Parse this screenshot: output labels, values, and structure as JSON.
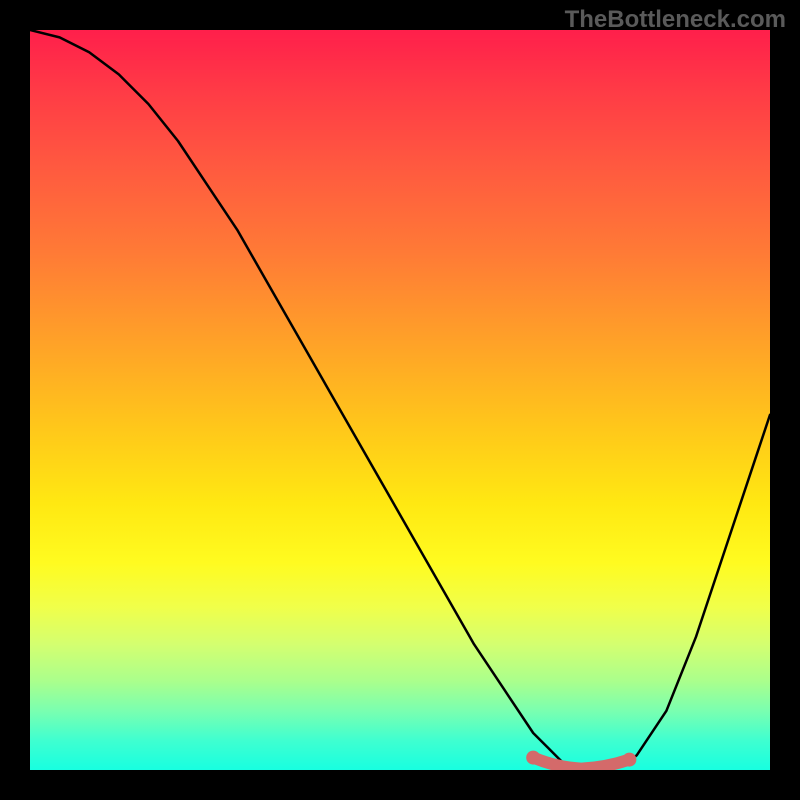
{
  "watermark": "TheBottleneck.com",
  "chart_data": {
    "type": "line",
    "title": "",
    "xlabel": "",
    "ylabel": "",
    "xlim": [
      0,
      100
    ],
    "ylim": [
      0,
      100
    ],
    "series": [
      {
        "name": "bottleneck-curve",
        "x": [
          0,
          4,
          8,
          12,
          16,
          20,
          24,
          28,
          32,
          36,
          40,
          44,
          48,
          52,
          56,
          60,
          64,
          68,
          70,
          72,
          74,
          76,
          78,
          80,
          82,
          86,
          90,
          94,
          98,
          100
        ],
        "values": [
          100,
          99,
          97,
          94,
          90,
          85,
          79,
          73,
          66,
          59,
          52,
          45,
          38,
          31,
          24,
          17,
          11,
          5,
          3,
          1,
          0.5,
          0.3,
          0.3,
          0.5,
          2,
          8,
          18,
          30,
          42,
          48
        ]
      }
    ],
    "highlight_band": {
      "name": "optimal-zone",
      "x_start": 68,
      "x_end": 81,
      "y": 0.6,
      "color": "#d46a6a"
    },
    "gradient_stops": [
      {
        "pos": 0,
        "color": "#ff1f4b"
      },
      {
        "pos": 8,
        "color": "#ff3a46"
      },
      {
        "pos": 18,
        "color": "#ff5840"
      },
      {
        "pos": 30,
        "color": "#ff7a36"
      },
      {
        "pos": 42,
        "color": "#ffa128"
      },
      {
        "pos": 54,
        "color": "#ffc81a"
      },
      {
        "pos": 64,
        "color": "#ffe812"
      },
      {
        "pos": 72,
        "color": "#fffb20"
      },
      {
        "pos": 78,
        "color": "#f0ff4a"
      },
      {
        "pos": 83,
        "color": "#d4ff70"
      },
      {
        "pos": 88,
        "color": "#aaff8c"
      },
      {
        "pos": 92,
        "color": "#7affb0"
      },
      {
        "pos": 96,
        "color": "#3fffd0"
      },
      {
        "pos": 100,
        "color": "#18ffe0"
      }
    ]
  },
  "colors": {
    "curve": "#000000",
    "highlight": "#d46a6a",
    "background": "#000000"
  }
}
